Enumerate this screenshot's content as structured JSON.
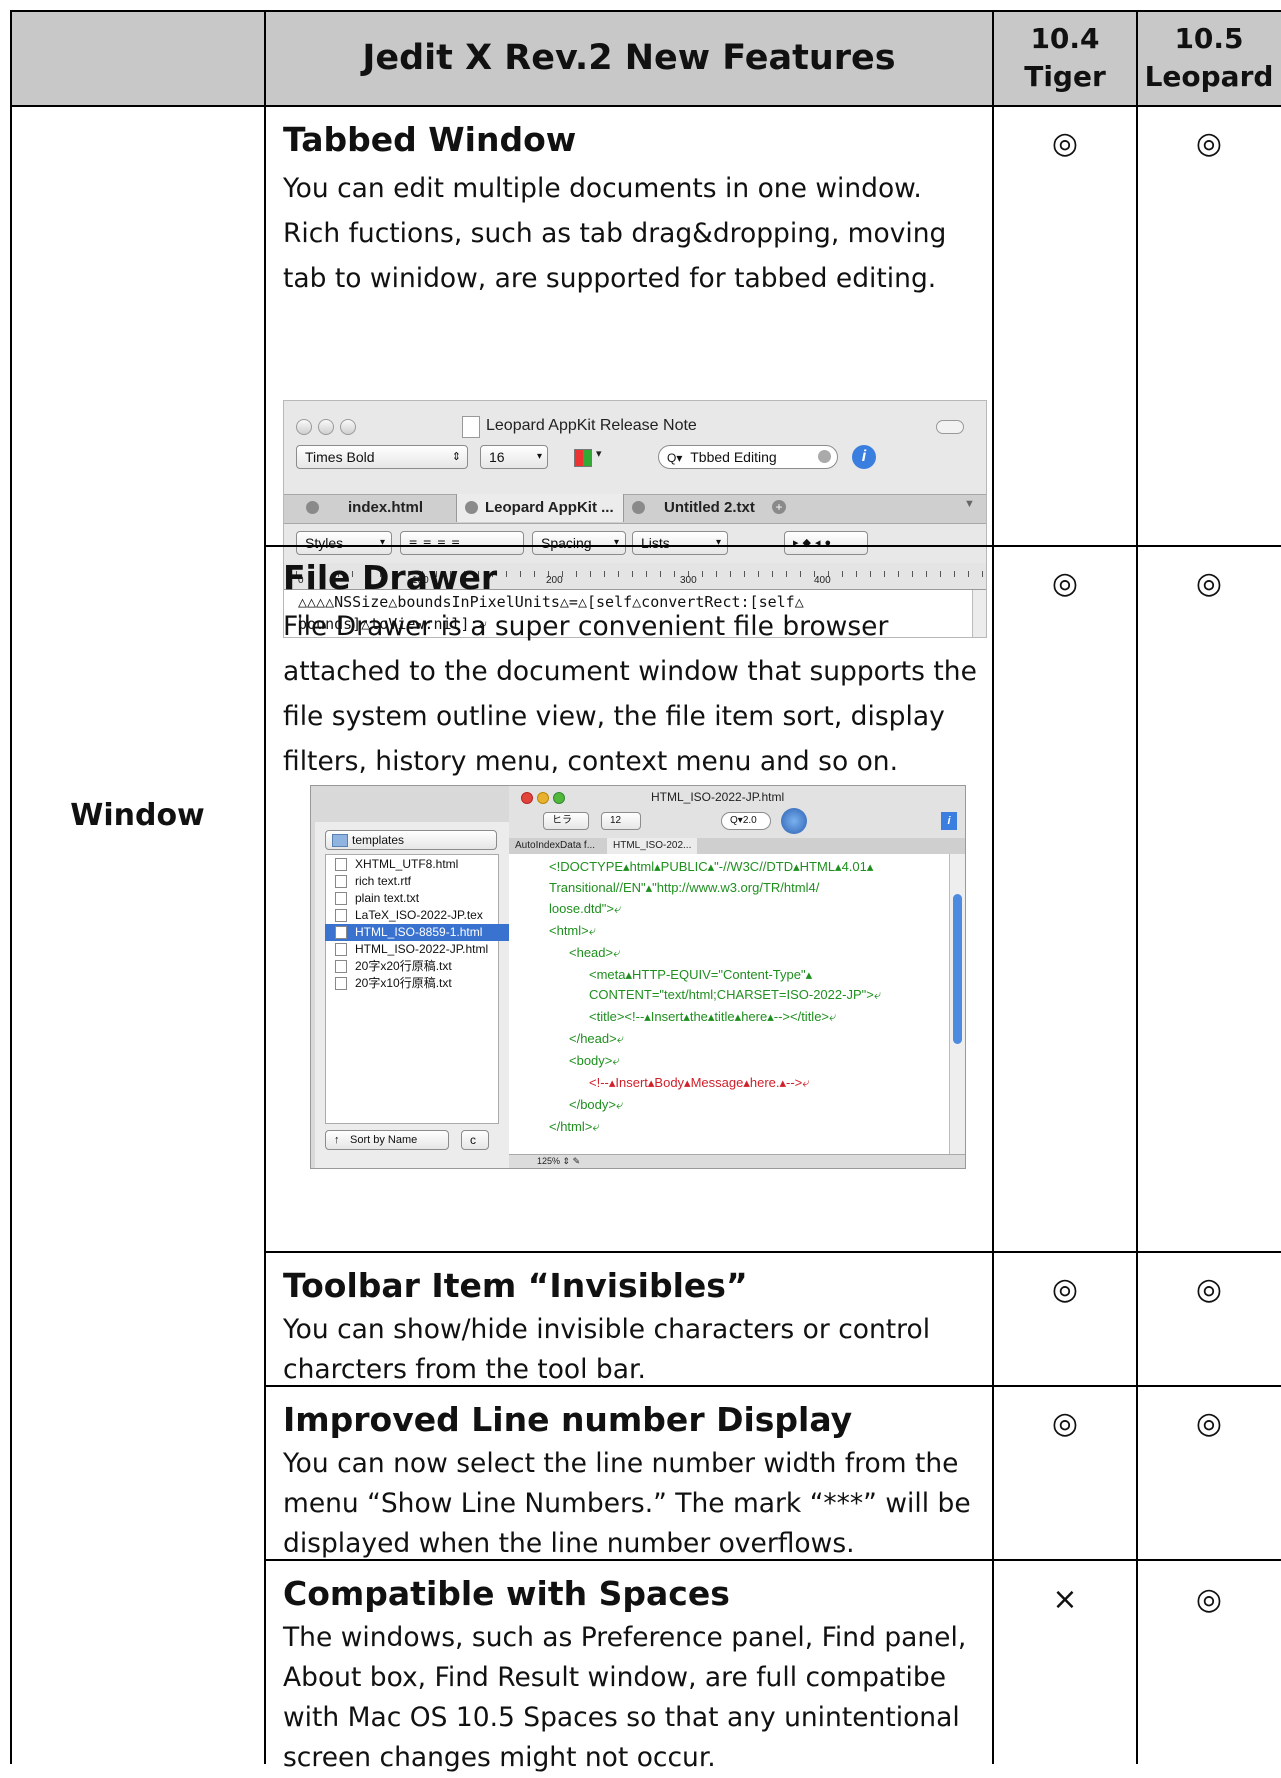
{
  "header": {
    "title": "Jedit X Rev.2 New Features",
    "versions": [
      {
        "num": "10.4",
        "name": "Tiger"
      },
      {
        "num": "10.5",
        "name": "Leopard"
      }
    ]
  },
  "category": "Window",
  "features": [
    {
      "title": "Tabbed Window",
      "description": "You can edit multiple documents in one window. Rich fuctions, such as tab drag&dropping, moving tab to winidow, are supported for tabbed editing.",
      "tiger": "◎",
      "leopard": "◎"
    },
    {
      "title": "File Drawer",
      "description": "File Drawer is a super convenient file browser attached to the document window that supports the file system outline view, the file item sort, display filters, history menu, context menu and so on.",
      "tiger": "◎",
      "leopard": "◎"
    },
    {
      "title": "Toolbar Item “Invisibles”",
      "description": "You can show/hide invisible characters or control charcters from the tool bar.",
      "tiger": "◎",
      "leopard": "◎"
    },
    {
      "title": "Improved Line number Display",
      "description": "You can now select the line number width from the menu “Show Line Numbers.”  The mark “***” will be displayed when the line number overflows.",
      "tiger": "◎",
      "leopard": "◎"
    },
    {
      "title": "Compatible with Spaces",
      "description": "The windows, such as Preference panel, Find panel, About box, Find Result window, are full compatibe with Mac OS 10.5 Spaces so that any unintentional screen changes might not occur.",
      "tiger": "×",
      "leopard": "◎"
    }
  ],
  "shot1": {
    "window_title": "Leopard AppKit Release Note",
    "font_popup": "Times Bold",
    "font_size": "16",
    "search_value": "Tbbed Editing",
    "tabs": [
      "index.html",
      "Leopard AppKit ...",
      "Untitled 2.txt"
    ],
    "styles_popup": "Styles",
    "spacing_popup": "Spacing",
    "lists_popup": "Lists",
    "ruler_labels": [
      "0",
      "100",
      "200",
      "300",
      "400"
    ],
    "code_lines": [
      "△△△△NSSize△boundsInPixelUnits△=△[self△convertRect:[self△",
      "bounds]△toView:nil];⤶"
    ]
  },
  "shot2": {
    "window_title": "HTML_ISO-2022-JP.html",
    "folder": "templates",
    "files": [
      "XHTML_UTF8.html",
      "rich text.rtf",
      "plain text.txt",
      "LaTeX_ISO-2022-JP.tex",
      "HTML_ISO-8859-1.html",
      "HTML_ISO-2022-JP.html",
      "20字x20行原稿.txt",
      "20字x10行原稿.txt"
    ],
    "selected_index": 4,
    "sort_label": "Sort by Name",
    "tabs": [
      "AutoIndexData f...",
      "HTML_ISO-202..."
    ],
    "size_popup": "12",
    "encoding_popup": "ヒラ",
    "search_value": "2.0",
    "zoom": "125%",
    "code_lines": [
      "<!DOCTYPE▴html▴PUBLIC▴\"-//W3C//DTD▴HTML▴4.01▴",
      "Transitional//EN\"▴\"http://www.w3.org/TR/html4/",
      "loose.dtd\">⤶",
      "<html>⤶",
      "<head>⤶",
      "<meta▴HTTP-EQUIV=\"Content-Type\"▴",
      "CONTENT=\"text/html;CHARSET=ISO-2022-JP\">⤶",
      "<title><!--▴Insert▴the▴title▴here▴--></title>⤶",
      "</head>⤶",
      "<body>⤶",
      "<!--▴Insert▴Body▴Message▴here.▴-->⤶",
      "</body>⤶",
      "</html>⤶"
    ]
  }
}
